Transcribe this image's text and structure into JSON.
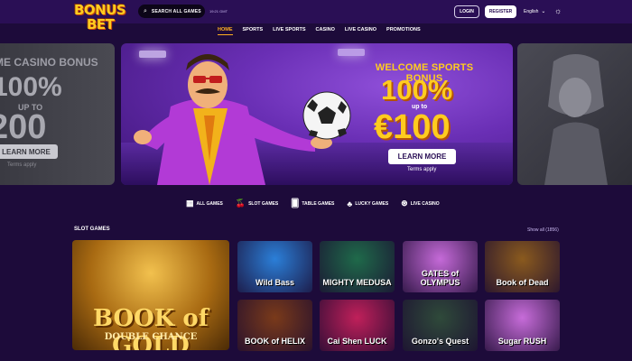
{
  "header": {
    "logo_line1": "BONUS",
    "logo_line2": "BET",
    "search_placeholder": "SEARCH ALL GAMES",
    "clock": "19:21 GMT",
    "login_label": "LOGIN",
    "register_label": "REGISTER",
    "language": "English"
  },
  "nav": {
    "items": [
      "HOME",
      "SPORTS",
      "LIVE SPORTS",
      "CASINO",
      "LIVE CASINO",
      "PROMOTIONS"
    ]
  },
  "banners": {
    "left": {
      "title": "ME CASINO BONUS",
      "pct": "100%",
      "upto": "UP TO",
      "amount": "200",
      "button": "LEARN MORE",
      "terms": "Terms apply"
    },
    "main": {
      "title": "WELCOME SPORTS BONUS",
      "pct": "100%",
      "upto": "up to",
      "amount": "€100",
      "button": "LEARN MORE",
      "terms": "Terms apply"
    }
  },
  "categories": [
    {
      "label": "ALL GAMES",
      "icon": "grid-icon"
    },
    {
      "label": "SLOT GAMES",
      "icon": "cherries-icon"
    },
    {
      "label": "TABLE GAMES",
      "icon": "cards-icon"
    },
    {
      "label": "LUCKY GAMES",
      "icon": "clover-icon"
    },
    {
      "label": "LIVE CASINO",
      "icon": "chip-icon"
    }
  ],
  "slot_games": {
    "title": "SLOT GAMES",
    "show_all": "Show all (1856)",
    "featured": {
      "title": "BOOK of GOLD",
      "subtitle": "DOUBLE CHANCE"
    },
    "games": [
      {
        "title": "Wild Bass",
        "color": "#2b7fd8"
      },
      {
        "title": "MIGHTY MEDUSA",
        "color": "#1f6a4a"
      },
      {
        "title": "GATES of OLYMPUS",
        "color": "#c56ad8"
      },
      {
        "title": "Book of Dead",
        "color": "#8a5a1e"
      },
      {
        "title": "BOOK of HELIX",
        "color": "#7a3a1a"
      },
      {
        "title": "Cai Shen LUCK",
        "color": "#c0205a"
      },
      {
        "title": "Gonzo's Quest",
        "color": "#2f4a3a"
      },
      {
        "title": "Sugar RUSH",
        "color": "#c76cd9"
      }
    ]
  }
}
